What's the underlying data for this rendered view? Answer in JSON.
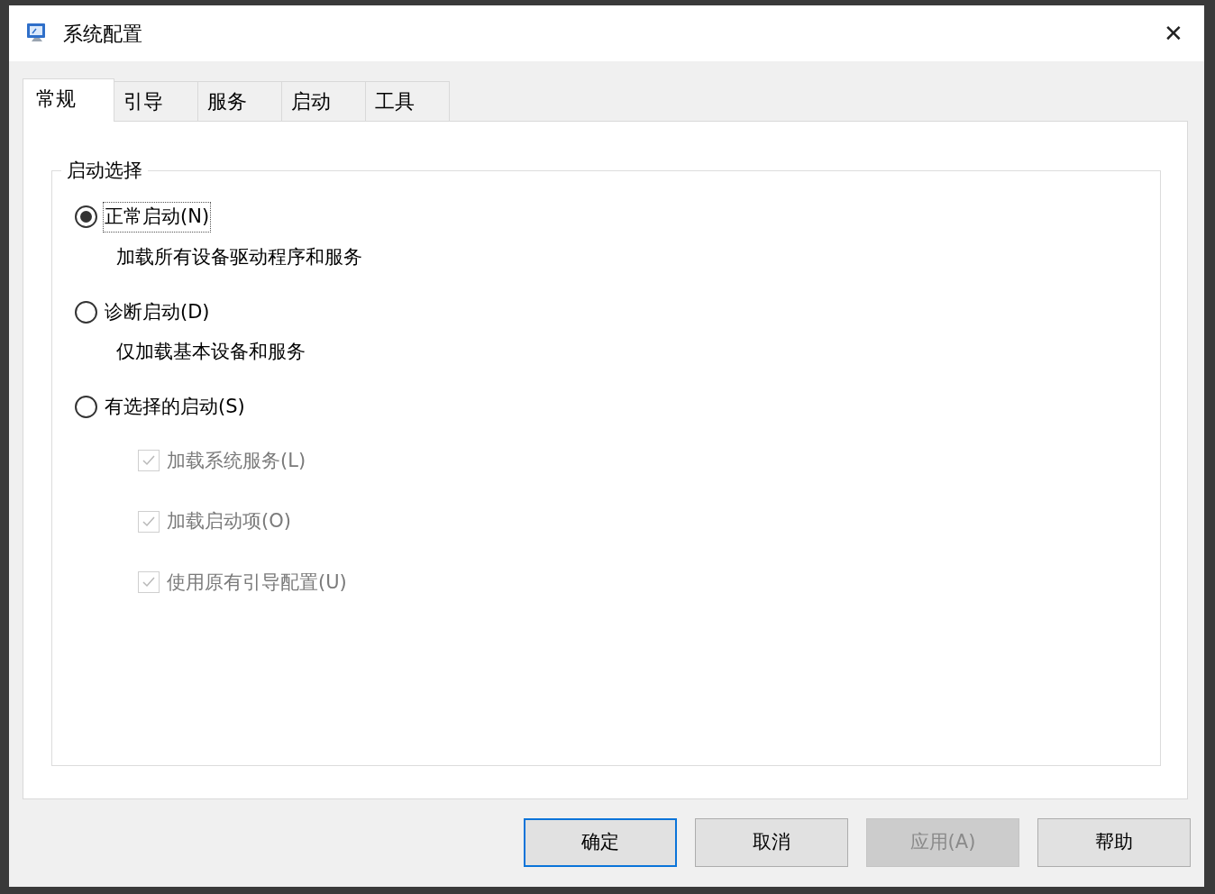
{
  "window": {
    "title": "系统配置",
    "close": "✕"
  },
  "tabs": [
    {
      "label": "常规",
      "selected": true
    },
    {
      "label": "引导",
      "selected": false
    },
    {
      "label": "服务",
      "selected": false
    },
    {
      "label": "启动",
      "selected": false
    },
    {
      "label": "工具",
      "selected": false
    }
  ],
  "group": {
    "title": "启动选择",
    "options": [
      {
        "label": "正常启动(N)",
        "description": "加载所有设备驱动程序和服务",
        "selected": true
      },
      {
        "label": "诊断启动(D)",
        "description": "仅加载基本设备和服务",
        "selected": false
      },
      {
        "label": "有选择的启动(S)",
        "selected": false
      }
    ],
    "checkboxes": [
      {
        "label": "加载系统服务(L)",
        "checked": true,
        "disabled": true
      },
      {
        "label": "加载启动项(O)",
        "checked": true,
        "disabled": true
      },
      {
        "label": "使用原有引导配置(U)",
        "checked": true,
        "disabled": true
      }
    ]
  },
  "buttons": [
    {
      "label": "确定",
      "default": true,
      "disabled": false
    },
    {
      "label": "取消",
      "default": false,
      "disabled": false
    },
    {
      "label": "应用(A)",
      "default": false,
      "disabled": true
    },
    {
      "label": "帮助",
      "default": false,
      "disabled": false
    }
  ]
}
